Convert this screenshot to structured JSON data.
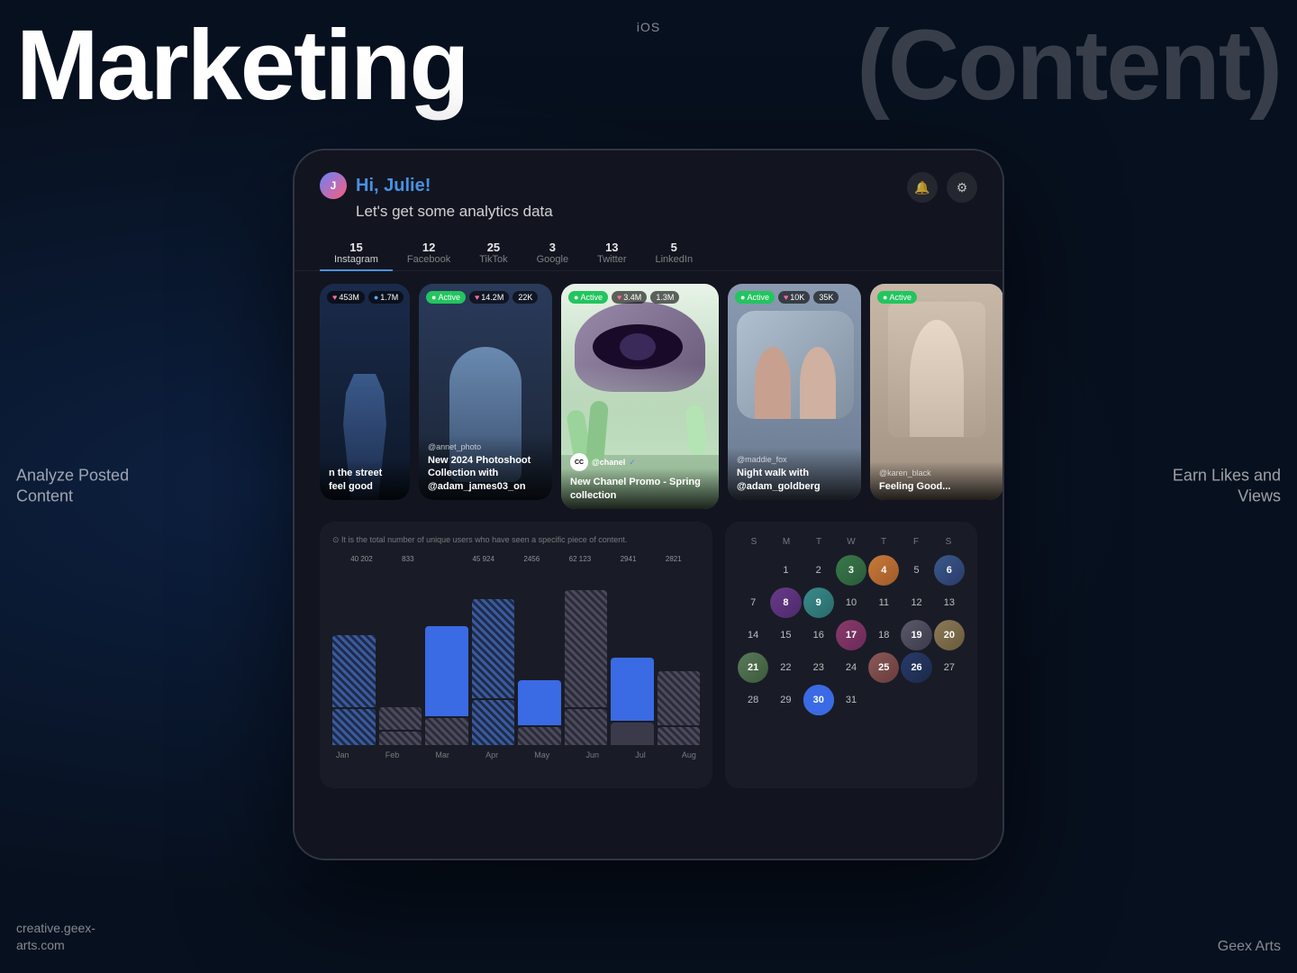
{
  "page": {
    "title_left": "Marketing",
    "title_right": "(Content)",
    "ios_label": "iOS",
    "side_left": "Analyze Posted\nContent",
    "side_right": "Earn Likes and\nViews",
    "bottom_left": "creative.geex-\narts.com",
    "bottom_right": "Geex Arts"
  },
  "app": {
    "greeting_hi": "Hi,",
    "greeting_name": " Julie!",
    "subtitle": "Let's get some analytics data",
    "notification_icon": "🔔",
    "settings_icon": "⚙"
  },
  "platform_tabs": [
    {
      "name": "Instagram",
      "count": "15",
      "active": true
    },
    {
      "name": "Facebook",
      "count": "12",
      "active": false
    },
    {
      "name": "TikTok",
      "count": "25",
      "active": false
    },
    {
      "name": "Google",
      "count": "3",
      "active": false
    },
    {
      "name": "Twitter",
      "count": "13",
      "active": false
    },
    {
      "name": "LinkedIn",
      "count": "5",
      "active": false
    }
  ],
  "content_cards": [
    {
      "id": 1,
      "size": "sm",
      "badges": [
        {
          "type": "stat",
          "icon": "♥",
          "value": "453M"
        },
        {
          "type": "stat",
          "icon": "👁",
          "value": "1.7M"
        }
      ],
      "username": "",
      "title": "n the street feel good",
      "bg": "1",
      "active": false
    },
    {
      "id": 2,
      "size": "md",
      "badges": [
        {
          "type": "active",
          "value": "Active"
        },
        {
          "type": "stat",
          "icon": "♥",
          "value": "14.2M"
        },
        {
          "type": "stat",
          "value": "22K"
        }
      ],
      "username": "@annet_photo",
      "title": "New 2024 Photoshoot Collection with @adam_james03_on",
      "bg": "2",
      "active": true
    },
    {
      "id": 3,
      "size": "lg",
      "badges": [
        {
          "type": "active",
          "value": "Active"
        },
        {
          "type": "stat",
          "icon": "♥",
          "value": "3.4M"
        },
        {
          "type": "stat",
          "value": "1.3M"
        }
      ],
      "username": "@chanel",
      "title": "New Chanel Promo - Spring collection",
      "bg": "3",
      "active": true,
      "chanel": true
    },
    {
      "id": 4,
      "size": "md",
      "badges": [
        {
          "type": "active",
          "value": "Active"
        },
        {
          "type": "stat",
          "icon": "♥",
          "value": "10K"
        },
        {
          "type": "stat",
          "value": "35K"
        }
      ],
      "username": "@maddie_fox",
      "title": "Night walk with @adam_goldberg",
      "bg": "4",
      "active": true
    },
    {
      "id": 5,
      "size": "md",
      "badges": [
        {
          "type": "active",
          "value": "Active"
        }
      ],
      "username": "@karen_black",
      "title": "Feeling Good...",
      "bg": "5",
      "active": true
    }
  ],
  "analytics": {
    "info_text": "⊙ It is the total number of unique users who have seen a specific piece of content.",
    "bars": [
      {
        "month": "Jan",
        "value": "40 202",
        "height_solid": 60,
        "height_striped": 80,
        "type_top": "striped-blue",
        "type_bottom": "striped-blue"
      },
      {
        "month": "Feb",
        "value": "833",
        "height_solid": 20,
        "height_striped": 30,
        "type_top": "striped-gray",
        "type_bottom": "striped-gray"
      },
      {
        "month": "Mar",
        "value": "",
        "height_solid": 80,
        "height_striped": 100,
        "type_top": "solid-blue",
        "type_bottom": "striped-gray"
      },
      {
        "month": "Apr",
        "value": "45 924",
        "height_solid": 90,
        "height_striped": 110,
        "type_top": "striped-blue",
        "type_bottom": "striped-blue"
      },
      {
        "month": "May",
        "value": "2456",
        "height_solid": 30,
        "height_striped": 50,
        "type_top": "solid-blue",
        "type_bottom": "striped-gray"
      },
      {
        "month": "Jun",
        "value": "62 123",
        "height_solid": 100,
        "height_striped": 130,
        "type_top": "striped-gray",
        "type_bottom": "striped-gray"
      },
      {
        "month": "Jul",
        "value": "2941",
        "height_solid": 40,
        "height_striped": 60,
        "type_top": "solid-blue",
        "type_bottom": "solid-gray"
      },
      {
        "month": "Aug",
        "value": "2821",
        "height_solid": 35,
        "height_striped": 55,
        "type_top": "striped-gray",
        "type_bottom": "striped-gray"
      }
    ]
  },
  "calendar": {
    "day_names": [
      "S",
      "M",
      "T",
      "W",
      "T",
      "F",
      "S"
    ],
    "days": [
      {
        "num": "",
        "img": null
      },
      {
        "num": "1",
        "img": null
      },
      {
        "num": "2",
        "img": null
      },
      {
        "num": "3",
        "img": "green"
      },
      {
        "num": "4",
        "img": "orange"
      },
      {
        "num": "5",
        "img": null
      },
      {
        "num": "6",
        "img": "blue"
      },
      {
        "num": "7",
        "img": null
      },
      {
        "num": "8",
        "img": "purple"
      },
      {
        "num": "9",
        "img": "teal"
      },
      {
        "num": "10",
        "img": null
      },
      {
        "num": "11",
        "img": null
      },
      {
        "num": "12",
        "img": null
      },
      {
        "num": "13",
        "img": null
      },
      {
        "num": "14",
        "img": null
      },
      {
        "num": "15",
        "img": null
      },
      {
        "num": "16",
        "img": null
      },
      {
        "num": "17",
        "img": "pink"
      },
      {
        "num": "18",
        "img": null
      },
      {
        "num": "19",
        "img": "gray"
      },
      {
        "num": "20",
        "img": "warm"
      },
      {
        "num": "21",
        "img": "sage"
      },
      {
        "num": "22",
        "img": null
      },
      {
        "num": "23",
        "img": null
      },
      {
        "num": "24",
        "img": null
      },
      {
        "num": "25",
        "img": "rose"
      },
      {
        "num": "26",
        "img": "navy"
      },
      {
        "num": "27",
        "img": null
      },
      {
        "num": "28",
        "img": null
      },
      {
        "num": "29",
        "img": null
      },
      {
        "num": "30",
        "img": "amber",
        "today": true
      },
      {
        "num": "31",
        "img": null
      }
    ]
  }
}
